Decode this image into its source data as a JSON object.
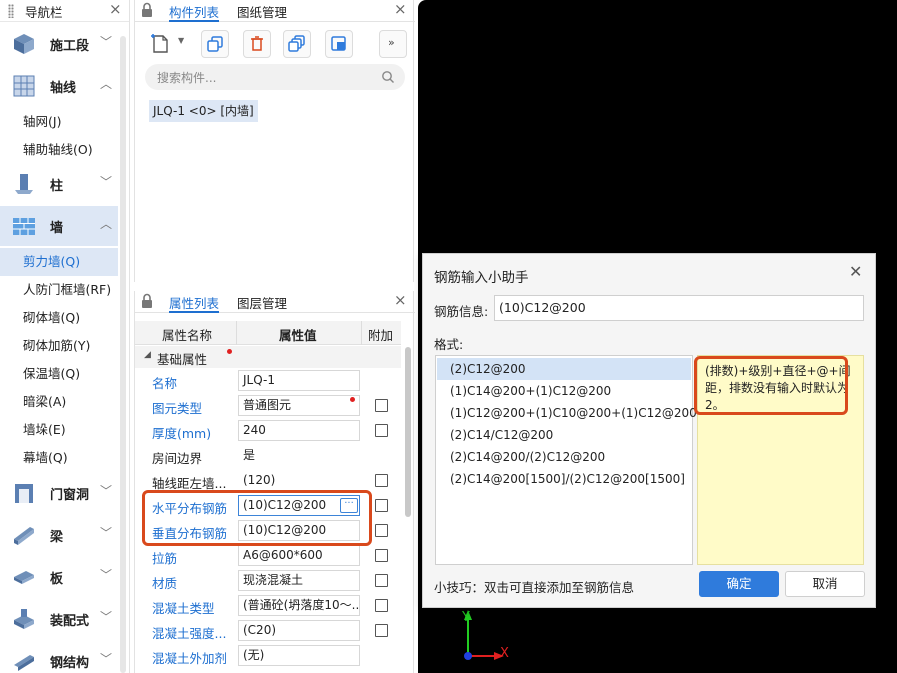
{
  "nav": {
    "title": "导航栏",
    "categories": [
      {
        "label": "施工段",
        "icon": "construction-section-icon"
      },
      {
        "label": "轴线",
        "icon": "axis-grid-icon"
      },
      {
        "label": "柱",
        "icon": "column-icon"
      },
      {
        "label": "墙",
        "icon": "wall-icon"
      },
      {
        "label": "门窗洞",
        "icon": "door-window-icon"
      },
      {
        "label": "梁",
        "icon": "beam-icon"
      },
      {
        "label": "板",
        "icon": "slab-icon"
      },
      {
        "label": "装配式",
        "icon": "prefab-icon"
      },
      {
        "label": "钢结构",
        "icon": "steel-structure-icon"
      }
    ],
    "axis_items": [
      "轴网(J)",
      "辅助轴线(O)"
    ],
    "wall_items": [
      "剪力墙(Q)",
      "人防门框墙(RF)",
      "砌体墙(Q)",
      "砌体加筋(Y)",
      "保温墙(Q)",
      "暗梁(A)",
      "墙垛(E)",
      "幕墙(Q)"
    ],
    "active_item": "剪力墙(Q)"
  },
  "component_panel": {
    "tabs": [
      "构件列表",
      "图纸管理"
    ],
    "active_tab": "构件列表",
    "search_placeholder": "搜索构件...",
    "items": [
      "JLQ-1 <0> [内墙]"
    ]
  },
  "property_panel": {
    "tabs": [
      "属性列表",
      "图层管理"
    ],
    "active_tab": "属性列表",
    "columns": [
      "属性名称",
      "属性值",
      "附加"
    ],
    "group": "基础属性",
    "rows": [
      {
        "name": "名称",
        "value": "JLQ-1",
        "blue": true,
        "checkbox": false
      },
      {
        "name": "图元类型",
        "value": "普通图元",
        "blue": true,
        "checkbox": true
      },
      {
        "name": "厚度(mm)",
        "value": "240",
        "blue": true,
        "checkbox": true
      },
      {
        "name": "房间边界",
        "value": "是",
        "blue": false,
        "checkbox": false
      },
      {
        "name": "轴线距左墙...",
        "value": "(120)",
        "blue": false,
        "checkbox": true
      },
      {
        "name": "水平分布钢筋",
        "value": "(10)C12@200",
        "blue": true,
        "checkbox": true
      },
      {
        "name": "垂直分布钢筋",
        "value": "(10)C12@200",
        "blue": true,
        "checkbox": true
      },
      {
        "name": "拉筋",
        "value": "A6@600*600",
        "blue": true,
        "checkbox": true
      },
      {
        "name": "材质",
        "value": "现浇混凝土",
        "blue": true,
        "checkbox": true
      },
      {
        "name": "混凝土类型",
        "value": "(普通砼(坍落度10～...",
        "blue": true,
        "checkbox": true
      },
      {
        "name": "混凝土强度...",
        "value": "(C20)",
        "blue": true,
        "checkbox": true
      },
      {
        "name": "混凝土外加剂",
        "value": "(无)",
        "blue": true,
        "checkbox": false
      }
    ]
  },
  "dialog": {
    "title": "钢筋输入小助手",
    "rebar_label": "钢筋信息:",
    "rebar_value": "(10)C12@200",
    "format_label": "格式:",
    "formats": [
      "(2)C12@200",
      "(1)C14@200+(1)C12@200",
      "(1)C12@200+(1)C10@200+(1)C12@200",
      "(2)C14/C12@200",
      "(2)C14@200/(2)C12@200",
      "(2)C14@200[1500]/(2)C12@200[1500]"
    ],
    "selected_format": "(2)C12@200",
    "description": "(排数)+级别+直径+@+间距，排数没有输入时默认为2。",
    "tip": "小技巧：双击可直接添加至钢筋信息",
    "ok_label": "确定",
    "cancel_label": "取消"
  },
  "axis_gizmo": {
    "x_label": "X",
    "y_label": "Y"
  },
  "colors": {
    "accent": "#1e6fd0",
    "highlight": "#d9491c",
    "primary_button": "#2f7bdc",
    "hint_bg": "#fffbc8"
  }
}
